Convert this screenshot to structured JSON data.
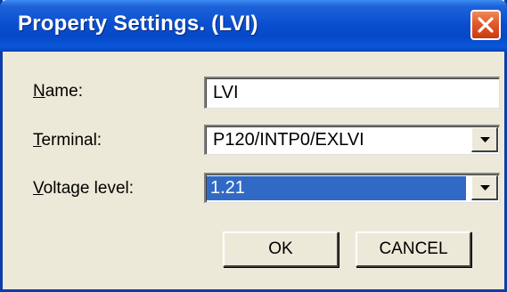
{
  "window": {
    "title": "Property Settings. (LVI)",
    "close_icon": "close-icon"
  },
  "form": {
    "name_label": "Name:",
    "name_mnemonic": "N",
    "name_rest": "ame:",
    "name_value": "LVI",
    "terminal_label": "Terminal:",
    "terminal_mnemonic": "T",
    "terminal_rest": "erminal:",
    "terminal_value": "P120/INTP0/EXLVI",
    "voltage_label": "Voltage level:",
    "voltage_mnemonic": "V",
    "voltage_rest": "oltage level:",
    "voltage_value": "1.21"
  },
  "buttons": {
    "ok_label": "OK",
    "cancel_label": "CANCEL"
  },
  "colors": {
    "titlebar": "#0648c8",
    "face": "#ece9d8",
    "selection": "#316ac5",
    "close": "#e25a2a"
  }
}
